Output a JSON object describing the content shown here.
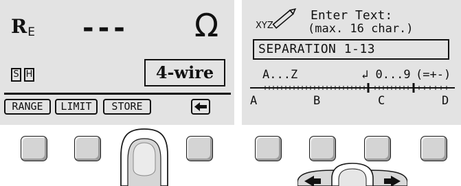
{
  "left_screen": {
    "quantity_symbol": "R",
    "quantity_subscript": "E",
    "value": "---",
    "unit": "Ω",
    "flag_s": "S",
    "flag_h": "H",
    "mode": "4-wire",
    "softkeys": [
      "RANGE",
      "LIMIT",
      "STORE"
    ],
    "arrow_icon": "left-arrow-icon"
  },
  "right_screen": {
    "pencil_label": "XYZ",
    "title_line1": "Enter Text:",
    "title_line2": "(max. 16 char.)",
    "text_value": "SEPARATION 1-13",
    "range_labels": [
      "A...Z",
      "↲ 0...9",
      "(=+-)"
    ],
    "column_labels": [
      "A",
      "B",
      "C",
      "D"
    ]
  },
  "colors": {
    "screen": "#e3e3e3",
    "key": "#d4d4d4",
    "ink": "#111111"
  }
}
